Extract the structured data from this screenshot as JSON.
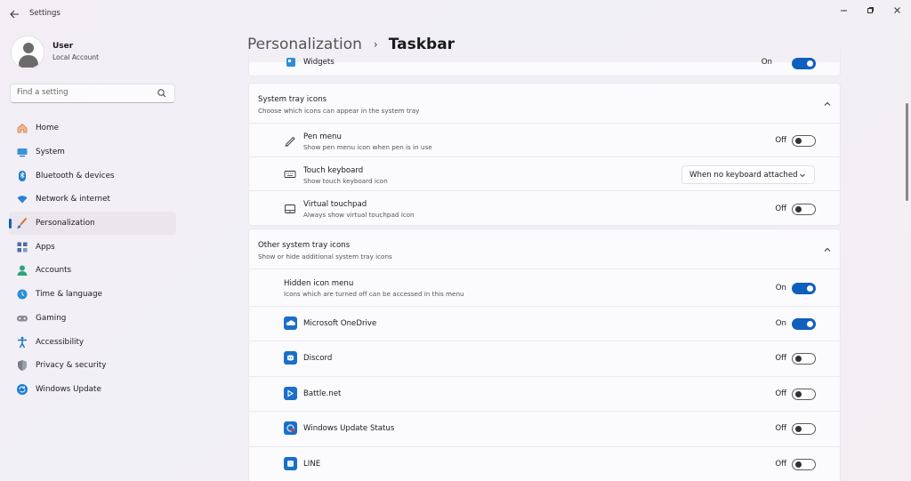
{
  "window": {
    "title": "Settings"
  },
  "user": {
    "name": "User",
    "account": "Local Account"
  },
  "search": {
    "placeholder": "Find a setting"
  },
  "sidebar": {
    "items": [
      {
        "label": "Home",
        "icon": "home-icon"
      },
      {
        "label": "System",
        "icon": "system-icon"
      },
      {
        "label": "Bluetooth & devices",
        "icon": "bluetooth-icon"
      },
      {
        "label": "Network & internet",
        "icon": "wifi-icon"
      },
      {
        "label": "Personalization",
        "icon": "brush-icon",
        "active": true
      },
      {
        "label": "Apps",
        "icon": "apps-icon"
      },
      {
        "label": "Accounts",
        "icon": "accounts-icon"
      },
      {
        "label": "Time & language",
        "icon": "globe-clock-icon"
      },
      {
        "label": "Gaming",
        "icon": "gamepad-icon"
      },
      {
        "label": "Accessibility",
        "icon": "accessibility-icon"
      },
      {
        "label": "Privacy & security",
        "icon": "shield-icon"
      },
      {
        "label": "Windows Update",
        "icon": "update-icon"
      }
    ]
  },
  "breadcrumb": {
    "parent": "Personalization",
    "separator": "›",
    "current": "Taskbar"
  },
  "widgets": {
    "title": "Widgets",
    "state": "On"
  },
  "system_tray": {
    "title": "System tray icons",
    "subtitle": "Choose which icons can appear in the system tray",
    "items": [
      {
        "title": "Pen menu",
        "subtitle": "Show pen menu icon when pen is in use",
        "state": "Off"
      },
      {
        "title": "Touch keyboard",
        "subtitle": "Show touch keyboard icon",
        "dropdown": "When no keyboard attached"
      },
      {
        "title": "Virtual touchpad",
        "subtitle": "Always show virtual touchpad icon",
        "state": "Off"
      }
    ]
  },
  "other_tray": {
    "title": "Other system tray icons",
    "subtitle": "Show or hide additional system tray icons",
    "hidden_menu": {
      "title": "Hidden icon menu",
      "subtitle": "Icons which are turned off can be accessed in this menu",
      "state": "On"
    },
    "apps": [
      {
        "title": "Microsoft OneDrive",
        "state": "On",
        "color": "#1a6fc9"
      },
      {
        "title": "Discord",
        "state": "Off",
        "color": "#1a6fc9"
      },
      {
        "title": "Battle.net",
        "state": "Off",
        "color": "#1a6fc9"
      },
      {
        "title": "Windows Update Status",
        "state": "Off",
        "color": "#1a6fc9"
      },
      {
        "title": "LINE",
        "state": "Off",
        "color": "#1a6fc9"
      }
    ]
  },
  "colors": {
    "accent": "#0f5fbf"
  }
}
